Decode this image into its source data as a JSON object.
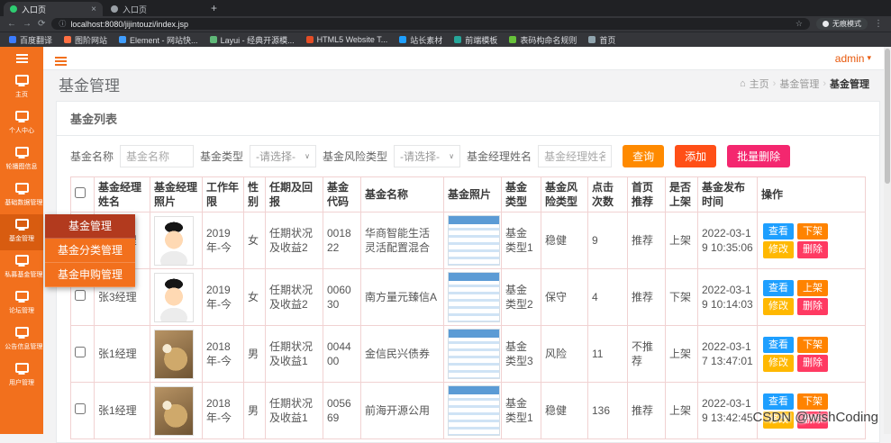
{
  "browser": {
    "tabs": [
      {
        "title": "入口页",
        "active": true,
        "favicon_color": "#2ecc71"
      },
      {
        "title": "入口页",
        "active": false,
        "favicon_color": "#9aa0a6"
      }
    ],
    "new_tab_icon": "+",
    "tab_close_icon": "×",
    "nav_back_icon": "←",
    "nav_forward_icon": "→",
    "nav_reload_icon": "⟳",
    "url_info_icon": "ⓘ",
    "url": "localhost:8080/jijintouzi/index.jsp",
    "star_icon": "☆",
    "menu_icon": "⋮",
    "incognito_label": "无痕模式",
    "bookmarks": [
      {
        "label": "百度翻译",
        "color": "#3b7cff"
      },
      {
        "label": "图阶网站",
        "color": "#ff7043"
      },
      {
        "label": "Element - 网站快...",
        "color": "#409eff"
      },
      {
        "label": "Layui - 经典开源模...",
        "color": "#5fb878"
      },
      {
        "label": "HTML5 Website T...",
        "color": "#e44d26"
      },
      {
        "label": "站长素材",
        "color": "#1e9fff"
      },
      {
        "label": "前端模板",
        "color": "#26a69a"
      },
      {
        "label": "表码构命名规则",
        "color": "#67c23a"
      },
      {
        "label": "首页",
        "color": "#90a4ae"
      }
    ]
  },
  "app": {
    "user": "admin",
    "caret_icon": "▾"
  },
  "page": {
    "title": "基金管理"
  },
  "breadcrumb": {
    "home_icon": "⌂",
    "separator": "›",
    "items": [
      "主页",
      "基金管理",
      "基金管理"
    ]
  },
  "sidebar": {
    "items": [
      {
        "label": "主页",
        "active": false
      },
      {
        "label": "个人中心",
        "active": false
      },
      {
        "label": "轮播图信息",
        "active": false
      },
      {
        "label": "基础数据管理",
        "active": false
      },
      {
        "label": "基金管理",
        "active": true
      },
      {
        "label": "私募基金管理",
        "active": false
      },
      {
        "label": "论坛管理",
        "active": false
      },
      {
        "label": "公告信息管理",
        "active": false
      },
      {
        "label": "用户管理",
        "active": false
      }
    ]
  },
  "submenu": {
    "items": [
      {
        "label": "基金管理",
        "active": true
      },
      {
        "label": "基金分类管理",
        "active": false
      },
      {
        "label": "基金申购管理",
        "active": false
      }
    ]
  },
  "panel": {
    "title": "基金列表"
  },
  "filters": {
    "name_label": "基金名称",
    "name_placeholder": "基金名称",
    "type_label": "基金类型",
    "type_value": "-请选择-",
    "risk_label": "基金风险类型",
    "risk_value": "-请选择-",
    "manager_label": "基金经理姓名",
    "manager_placeholder": "基金经理姓名",
    "chevron_icon": "∨",
    "query_button": "查询",
    "add_button": "添加",
    "batch_delete_button": "批量删除"
  },
  "table": {
    "headers": [
      "基金经理姓名",
      "基金经理照片",
      "工作年限",
      "性别",
      "任期及回报",
      "基金代码",
      "基金名称",
      "基金照片",
      "基金类型",
      "基金风险类型",
      "点击次数",
      "首页推荐",
      "是否上架",
      "基金发布时间",
      "操作"
    ],
    "rows": [
      {
        "manager": "张3经理",
        "photo": "baby",
        "years": "2019年-今",
        "gender": "女",
        "term": "任期状况及收益2",
        "code": "001822",
        "fund_name": "华商智能生活灵活配置混合",
        "fund_type": "基金类型1",
        "risk": "稳健",
        "clicks": "9",
        "recommend": "推荐",
        "shelf": "上架",
        "time": "2022-03-19 10:35:06",
        "actions": [
          {
            "label": "查看",
            "style": "blue"
          },
          {
            "label": "下架",
            "style": "orange"
          },
          {
            "label": "修改",
            "style": "yellow"
          },
          {
            "label": "删除",
            "style": "red"
          }
        ]
      },
      {
        "manager": "张3经理",
        "photo": "baby",
        "years": "2019年-今",
        "gender": "女",
        "term": "任期状况及收益2",
        "code": "006030",
        "fund_name": "南方量元臻信A",
        "fund_type": "基金类型2",
        "risk": "保守",
        "clicks": "4",
        "recommend": "推荐",
        "shelf": "下架",
        "time": "2022-03-19 10:14:03",
        "actions": [
          {
            "label": "查看",
            "style": "blue"
          },
          {
            "label": "上架",
            "style": "orange"
          },
          {
            "label": "修改",
            "style": "yellow"
          },
          {
            "label": "删除",
            "style": "red"
          }
        ]
      },
      {
        "manager": "张1经理",
        "photo": "cat",
        "years": "2018年-今",
        "gender": "男",
        "term": "任期状况及收益1",
        "code": "004400",
        "fund_name": "金信民兴债券",
        "fund_type": "基金类型3",
        "risk": "风险",
        "clicks": "11",
        "recommend": "不推荐",
        "shelf": "上架",
        "time": "2022-03-17 13:47:01",
        "actions": [
          {
            "label": "查看",
            "style": "blue"
          },
          {
            "label": "下架",
            "style": "orange"
          },
          {
            "label": "修改",
            "style": "yellow"
          },
          {
            "label": "删除",
            "style": "red"
          }
        ]
      },
      {
        "manager": "张1经理",
        "photo": "cat",
        "years": "2018年-今",
        "gender": "男",
        "term": "任期状况及收益1",
        "code": "005669",
        "fund_name": "前海开源公用",
        "fund_type": "基金类型1",
        "risk": "稳健",
        "clicks": "136",
        "recommend": "推荐",
        "shelf": "上架",
        "time": "2022-03-19 13:42:45",
        "actions": [
          {
            "label": "查看",
            "style": "blue"
          },
          {
            "label": "下架",
            "style": "orange"
          },
          {
            "label": "修改",
            "style": "yellow"
          },
          {
            "label": "删除",
            "style": "red"
          }
        ]
      }
    ]
  },
  "colors": {
    "sidebar": "#F2701D",
    "sidebar_active": "#D85C10",
    "submenu_active": "#B23A1E",
    "query_button": "#FF8A00",
    "add_button": "#FF4F17",
    "batch_delete_button": "#F4276F",
    "action_view": "#1E9FFF",
    "action_shelf": "#FF8300",
    "action_edit": "#FFB800",
    "action_delete": "#FF3A62"
  },
  "watermark": "CSDN @wishCoding"
}
